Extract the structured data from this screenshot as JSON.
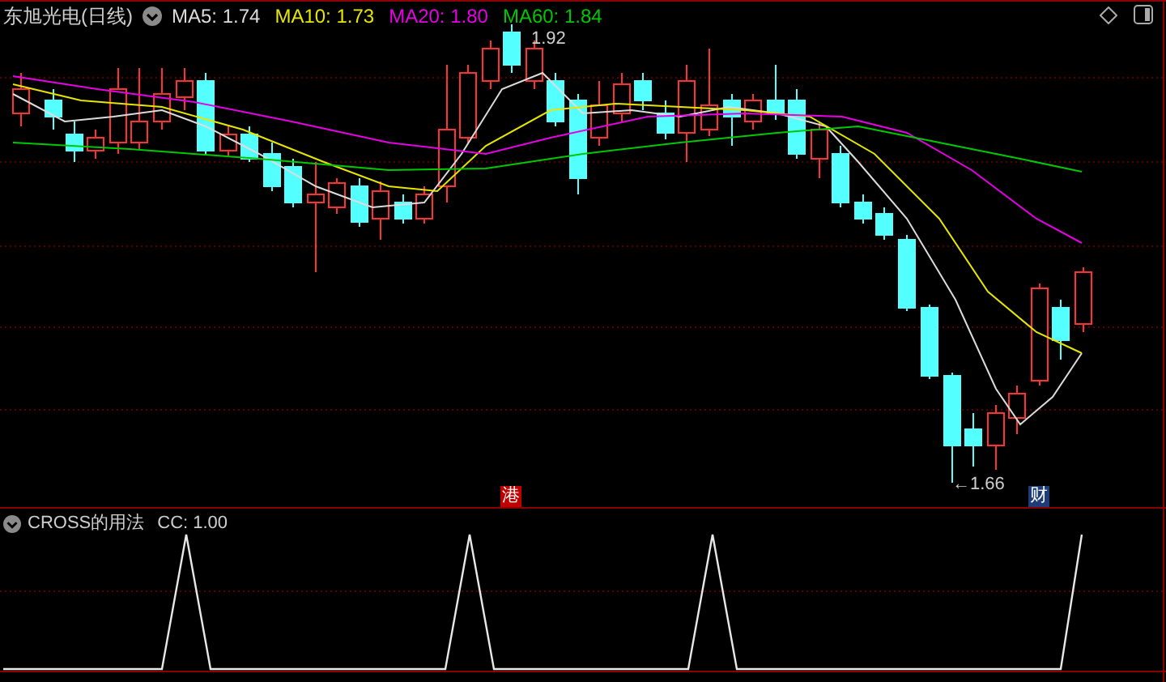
{
  "header": {
    "title": "东旭光电(日线)",
    "averages": [
      {
        "label": "MA5: 1.74",
        "color": "#dcdcdc"
      },
      {
        "label": "MA10: 1.73",
        "color": "#e6e600"
      },
      {
        "label": "MA20: 1.80",
        "color": "#e600e6"
      },
      {
        "label": "MA60: 1.84",
        "color": "#00c800"
      }
    ]
  },
  "price_chart": {
    "high_label": "1.92",
    "low_label": "←1.66",
    "events": [
      {
        "label": "港",
        "color": "#c00000"
      },
      {
        "label": "财",
        "color": "#1e3c78"
      }
    ]
  },
  "indicator": {
    "title": "CROSS的用法",
    "reading": "CC: 1.00"
  }
}
